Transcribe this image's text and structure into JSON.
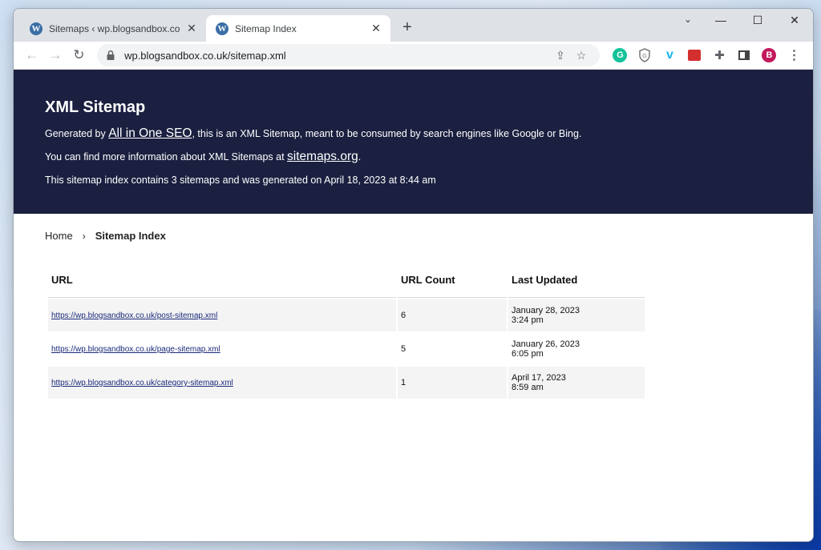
{
  "browser": {
    "tabs": [
      {
        "title": "Sitemaps ‹ wp.blogsandbox.co.uk",
        "favicon": "wordpress-icon",
        "active": false
      },
      {
        "title": "Sitemap Index",
        "favicon": "wordpress-icon",
        "active": true
      }
    ],
    "favicon_letter": "W",
    "address": "wp.blogsandbox.co.uk/sitemap.xml",
    "profile_initial": "B",
    "colors": {
      "profile": "#c2185b",
      "grammarly": "#15c39a",
      "vimeo": "#1ab7ea",
      "red_ext": "#d32f2f"
    }
  },
  "page": {
    "title": "XML Sitemap",
    "intro": {
      "prefix": "Generated by ",
      "link": "All in One SEO",
      "suffix": ", this is an XML Sitemap, meant to be consumed by search engines like Google or Bing."
    },
    "more_info": {
      "prefix": "You can find more information about XML Sitemaps at ",
      "link": "sitemaps.org",
      "suffix": "."
    },
    "summary": "This sitemap index contains 3 sitemaps and was generated on April 18, 2023 at 8:44 am",
    "header_color": "#1b2040"
  },
  "breadcrumb": {
    "home": "Home",
    "separator": "›",
    "current": "Sitemap Index"
  },
  "table": {
    "headers": {
      "url": "URL",
      "count": "URL Count",
      "updated": "Last Updated"
    },
    "rows": [
      {
        "url": "https://wp.blogsandbox.co.uk/post-sitemap.xml",
        "count": "6",
        "date": "January 28, 2023",
        "time": "3:24 pm"
      },
      {
        "url": "https://wp.blogsandbox.co.uk/page-sitemap.xml",
        "count": "5",
        "date": "January 26, 2023",
        "time": "6:05 pm"
      },
      {
        "url": "https://wp.blogsandbox.co.uk/category-sitemap.xml",
        "count": "1",
        "date": "April 17, 2023",
        "time": "8:59 am"
      }
    ]
  }
}
